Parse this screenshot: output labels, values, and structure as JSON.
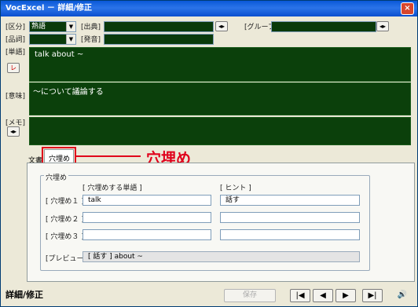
{
  "window": {
    "title": "VocExcel － 詳細/修正",
    "close": "×"
  },
  "fields": {
    "category_label": "[区分]",
    "category_value": "熟語",
    "source_label": "[出典]",
    "group_label": "[グループ]",
    "pos_label": "[品詞]",
    "pronunciation_label": "[発音]",
    "word_label": "[単語]",
    "word_value": "talk about ~",
    "word_button": "レ",
    "meaning_label": "[意味]",
    "meaning_value": "～について議論する",
    "memo_label": "[メモ]"
  },
  "tabs": [
    {
      "label": "文書"
    },
    {
      "label": "穴埋め"
    }
  ],
  "annotation": {
    "text": "穴埋め",
    "color": "#e0001b"
  },
  "cloze": {
    "group_title": "穴埋め",
    "col_word": "[ 穴埋めする単語 ]",
    "col_hint": "[ ヒント ]",
    "rows": [
      {
        "label": "[ 穴埋め１ ]",
        "word": "talk",
        "hint": "話す"
      },
      {
        "label": "[ 穴埋め２ ]",
        "word": "",
        "hint": ""
      },
      {
        "label": "[ 穴埋め３ ]",
        "word": "",
        "hint": ""
      }
    ],
    "preview_label": "[プレビュー]",
    "preview_value": "[ 話す ] about ~"
  },
  "footer": {
    "status": "詳細/修正",
    "save": "保存",
    "first": "|◀",
    "prev": "◀",
    "next": "▶",
    "last": "▶|",
    "sound": "🔊"
  }
}
